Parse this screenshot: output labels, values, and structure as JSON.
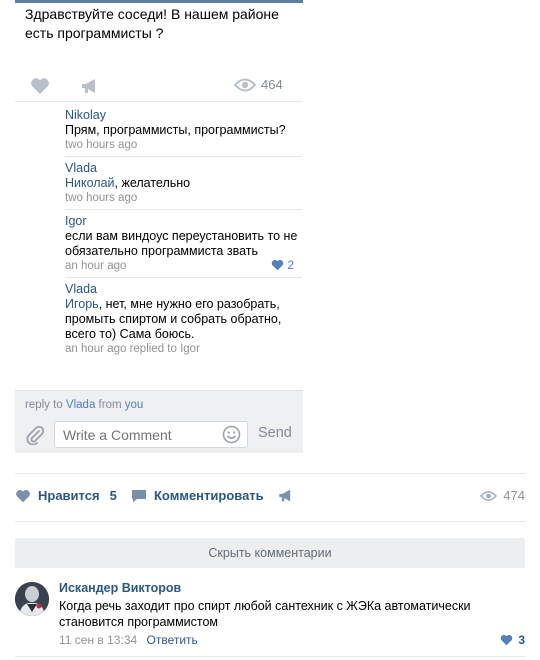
{
  "embedded_post": {
    "text": "Здравствуйте соседи! В нашем районе есть программисты ?",
    "views": "464",
    "comments": [
      {
        "author": "Nikolay",
        "text": "Прям, программисты, программисты?",
        "meta": "two hours ago"
      },
      {
        "author": "Vlada",
        "mention": "Николай",
        "text": ", желательно",
        "meta": "two hours ago"
      },
      {
        "author": "Igor",
        "text": "если вам виндоус переустановить то не обязательно программиста звать",
        "meta": "an hour ago",
        "likes": "2"
      },
      {
        "author": "Vlada",
        "mention": "Игорь",
        "text": ", нет, мне нужно его разобрать, промыть спиртом и собрать обратно, всего то) Сама боюсь.",
        "meta": "an hour ago replied to Igor"
      }
    ],
    "reply_bar": {
      "reply_to_prefix": "reply to",
      "reply_to_name": "Vlada",
      "from_word": "from",
      "from_name": "you",
      "placeholder": "Write a Comment",
      "send_label": "Send"
    }
  },
  "wall_actions": {
    "like_label": "Нравится",
    "like_count": "5",
    "comment_label": "Комментировать",
    "views": "474"
  },
  "hide_comments_label": "Скрыть комментарии",
  "wall_comment": {
    "author": "Искандер Викторов",
    "text": "Когда речь заходит про спирт любой сантехник с ЖЭКа автоматически становится программистом",
    "date": "11 сен в 13:34",
    "reply_label": "Ответить",
    "likes": "3"
  },
  "colors": {
    "link": "#2a5885",
    "accent": "#5181b8",
    "muted": "#939393",
    "icon_gray": "#b9c0c9"
  }
}
